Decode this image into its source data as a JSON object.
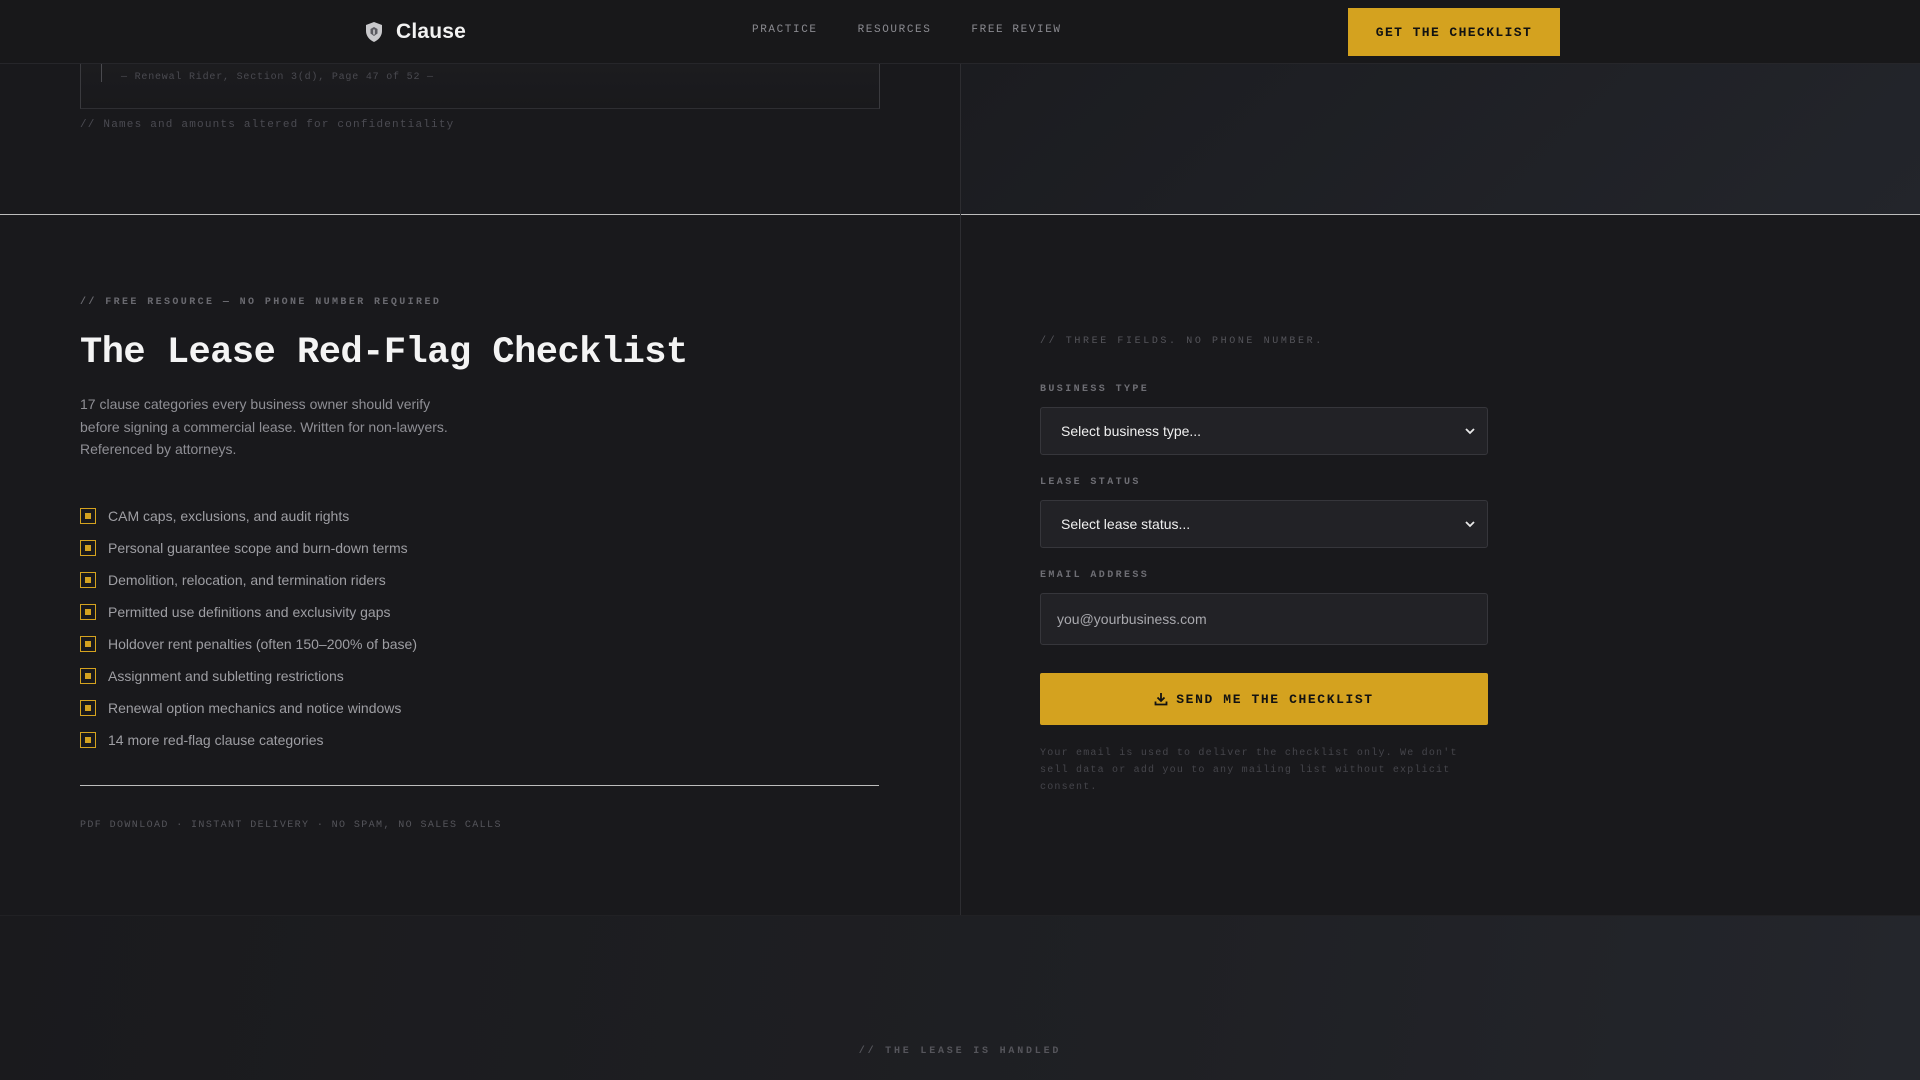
{
  "nav": {
    "brand": "Clause",
    "links": [
      "PRACTICE",
      "RESOURCES",
      "FREE REVIEW"
    ],
    "cta": "GET THE CHECKLIST"
  },
  "top_strip": {
    "doc_caption": "— Renewal Rider, Section 3(d), Page 47 of 52 —",
    "confidentiality_note": "// Names and amounts altered for confidentiality"
  },
  "hero": {
    "eyebrow": "// FREE RESOURCE — NO PHONE NUMBER REQUIRED",
    "title": "The Lease Red-Flag Checklist",
    "subtext": "17 clause categories every business owner should verify before signing a commercial lease. Written for non-lawyers. Referenced by attorneys.",
    "checklist": [
      "CAM caps, exclusions, and audit rights",
      "Personal guarantee scope and burn-down terms",
      "Demolition, relocation, and termination riders",
      "Permitted use definitions and exclusivity gaps",
      "Holdover rent penalties (often 150–200% of base)",
      "Assignment and subletting restrictions",
      "Renewal option mechanics and notice windows",
      "14 more red-flag clause categories"
    ],
    "footnote": "PDF DOWNLOAD · INSTANT DELIVERY · NO SPAM, NO SALES CALLS"
  },
  "form": {
    "eyebrow": "// THREE FIELDS. NO PHONE NUMBER.",
    "business_type_label": "BUSINESS TYPE",
    "business_type_value": "Select business type...",
    "lease_status_label": "LEASE STATUS",
    "lease_status_value": "Select lease status...",
    "email_label": "EMAIL ADDRESS",
    "email_placeholder": "you@yourbusiness.com",
    "submit_label": "SEND ME THE CHECKLIST",
    "privacy": "Your email is used to deliver the checklist only. We don't sell data or add you to any mailing list without explicit consent."
  },
  "bottom": {
    "eyebrow": "// THE LEASE IS HANDLED"
  },
  "colors": {
    "accent": "#d4a21f",
    "background": "#19191c"
  },
  "icons": {
    "brand": "shield-icon",
    "submit": "download-icon",
    "select": "chevron-down-icon",
    "check": "checkbox-icon"
  }
}
